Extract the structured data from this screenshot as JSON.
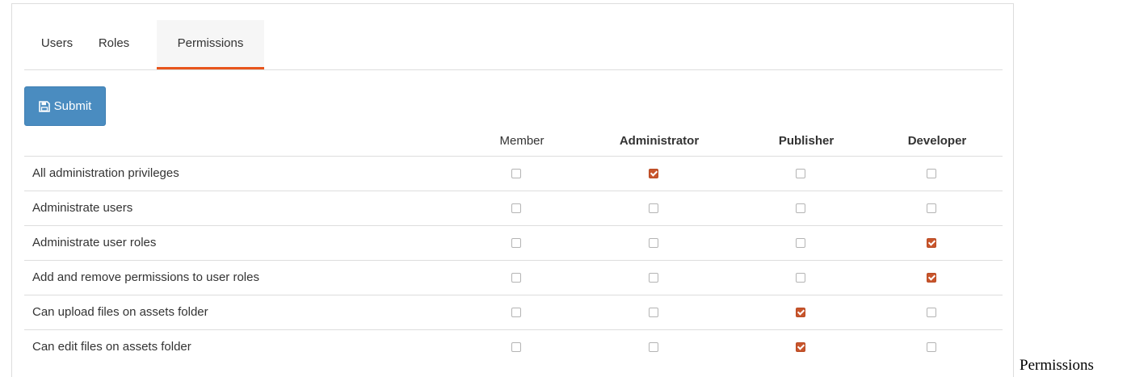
{
  "tabs": [
    {
      "label": "Users",
      "active": false
    },
    {
      "label": "Roles",
      "active": false
    },
    {
      "label": "Permissions",
      "active": true
    }
  ],
  "submit": {
    "label": "Submit",
    "icon": "save-icon"
  },
  "columns": [
    {
      "label": "Member",
      "bold": false
    },
    {
      "label": "Administrator",
      "bold": true
    },
    {
      "label": "Publisher",
      "bold": true
    },
    {
      "label": "Developer",
      "bold": true
    }
  ],
  "rows": [
    {
      "label": "All administration privileges",
      "checked": [
        false,
        true,
        false,
        false
      ]
    },
    {
      "label": "Administrate users",
      "checked": [
        false,
        false,
        false,
        false
      ]
    },
    {
      "label": "Administrate user roles",
      "checked": [
        false,
        false,
        false,
        true
      ]
    },
    {
      "label": "Add and remove permissions to user roles",
      "checked": [
        false,
        false,
        false,
        true
      ]
    },
    {
      "label": "Can upload files on assets folder",
      "checked": [
        false,
        false,
        true,
        false
      ]
    },
    {
      "label": "Can edit files on assets folder",
      "checked": [
        false,
        false,
        true,
        false
      ]
    }
  ],
  "colors": {
    "accent": "#e8551c",
    "checked": "#c8552c",
    "button": "#4a8cc0"
  },
  "caption": "Permissions"
}
